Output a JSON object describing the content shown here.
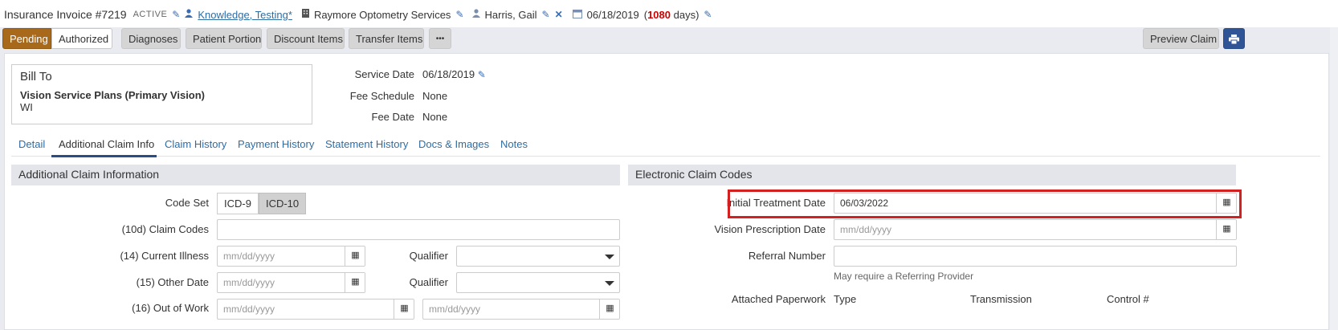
{
  "header": {
    "invoice_title": "Insurance Invoice #7219",
    "status": "ACTIVE",
    "patient_link": "Knowledge, Testing*",
    "location": "Raymore Optometry Services",
    "provider": "Harris, Gail",
    "service_date": "06/18/2019",
    "days_open": "1080",
    "days_prefix": "(",
    "days_suffix": "days)"
  },
  "buttons": {
    "pending": "Pending",
    "authorized": "Authorized",
    "diagnoses": "Diagnoses",
    "patient_portion": "Patient Portion",
    "discount_items": "Discount Items",
    "transfer_items": "Transfer Items",
    "more": "•••",
    "preview_claim": "Preview Claim"
  },
  "bill_to": {
    "title": "Bill To",
    "plan": "Vision Service Plans (Primary Vision)",
    "state": "WI"
  },
  "summary": {
    "service_date_label": "Service Date",
    "service_date_value": "06/18/2019",
    "fee_schedule_label": "Fee Schedule",
    "fee_schedule_value": "None",
    "fee_date_label": "Fee Date",
    "fee_date_value": "None"
  },
  "tabs": [
    "Detail",
    "Additional Claim Info",
    "Claim History",
    "Payment History",
    "Statement History",
    "Docs & Images",
    "Notes"
  ],
  "left_section": {
    "title": "Additional Claim Information",
    "code_set_label": "Code Set",
    "code_set_options": [
      "ICD-9",
      "ICD-10"
    ],
    "code_set_selected": "ICD-10",
    "claim_codes_label": "(10d) Claim Codes",
    "current_illness_label": "(14) Current Illness",
    "other_date_label": "(15) Other Date",
    "out_of_work_label": "(16) Out of Work",
    "qualifier_label": "Qualifier",
    "date_placeholder": "mm/dd/yyyy"
  },
  "right_section": {
    "title": "Electronic Claim Codes",
    "initial_treatment_label": "Initial Treatment Date",
    "initial_treatment_value": "06/03/2022",
    "vision_rx_label": "Vision Prescription Date",
    "date_placeholder": "mm/dd/yyyy",
    "referral_label": "Referral Number",
    "referral_hint": "May require a Referring Provider",
    "attached_label": "Attached Paperwork",
    "col_type": "Type",
    "col_transmission": "Transmission",
    "col_control": "Control #"
  },
  "colors": {
    "pending": "#a8691a",
    "primary": "#2f5597",
    "link": "#2e6da4",
    "highlight": "#d32020"
  }
}
